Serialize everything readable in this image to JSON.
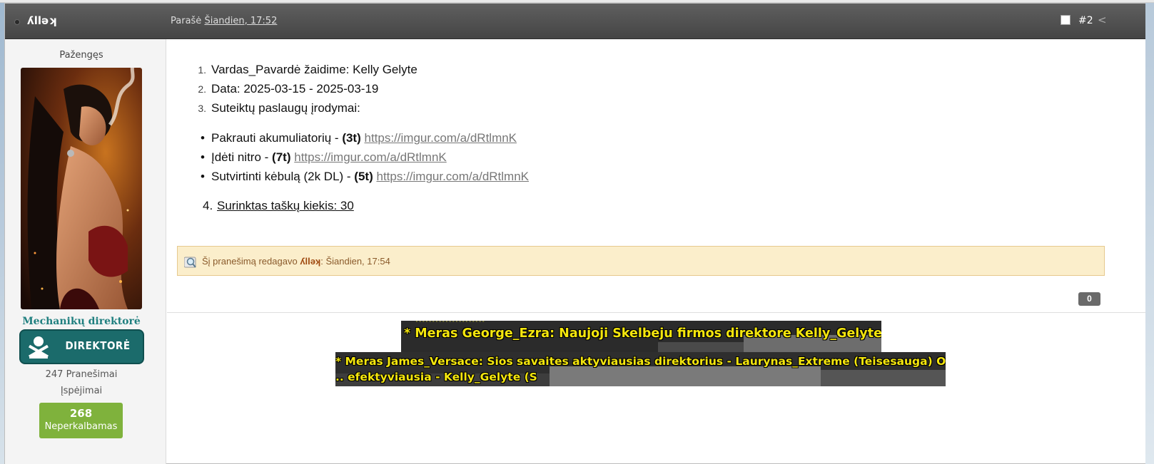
{
  "post": {
    "author": "ʎllǝʞ",
    "posted_prefix": "Parašė",
    "posted_date": "Šiandien, 17:52",
    "post_number": "#2",
    "share_icon": "share-icon"
  },
  "sidebar": {
    "group": "Pažengęs",
    "rank_title": "Mechanikų direktorė",
    "rank_badge": "DIREKTORĖ",
    "posts_count": "247 Pranešimai",
    "warnings": "Įspėjimai",
    "reputation_value": "268",
    "reputation_label": "Neperkalbamas"
  },
  "content": {
    "list": [
      {
        "num": "1.",
        "text": "Vardas_Pavardė žaidime: Kelly Gelyte"
      },
      {
        "num": "2.",
        "text": "Data: 2025-03-15 - 2025-03-19"
      },
      {
        "num": "3.",
        "text": "Suteiktų paslaugų įrodymai:"
      }
    ],
    "services": [
      {
        "label": "Pakrauti akumuliatorių - ",
        "points": "(3t)",
        "link": "https://imgur.com/a/dRtlmnK"
      },
      {
        "label": "Įdėti nitro - ",
        "points": "(7t)",
        "link": "https://imgur.com/a/dRtlmnK"
      },
      {
        "label": "Sutvirtinti kėbulą (2k DL) - ",
        "points": "(5t)",
        "link": "https://imgur.com/a/dRtlmnK"
      }
    ],
    "total_num": "4.",
    "total_text": "Surinktas taškų kiekis: 30"
  },
  "edit_note": {
    "prefix": "Šį pranešimą redagavo ",
    "author": "ʎllǝʞ",
    "suffix": ": Šiandien, 17:54"
  },
  "like_count": "0",
  "game_messages": {
    "line1": "* Meras George_Ezra: Naujoji Skelbeju firmos direktore Kelly_Gelyte!",
    "line2": "* Meras James_Versace: Sios savaites aktyviausias direktorius - Laurynas_Extreme (Teisesauga) O...",
    "line3": ".. efektyviausia - Kelly_Gelyte (S"
  },
  "colors": {
    "header_bg": "#4e4e4e",
    "rank_title": "#1f7f7f",
    "rank_badge": "#1b6b6b",
    "reputation": "#7fb23c",
    "edit_bg": "#fbeecb",
    "game_text": "#f4e60d"
  }
}
